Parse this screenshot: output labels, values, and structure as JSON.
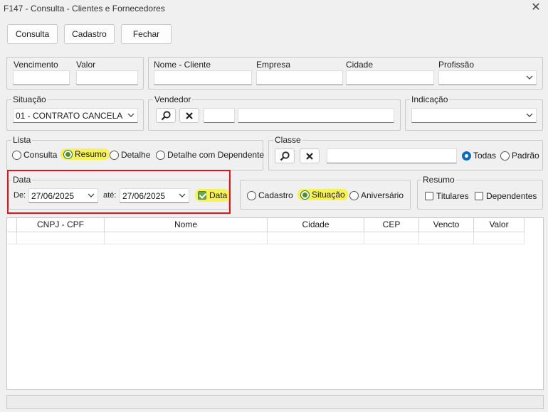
{
  "window": {
    "title": "F147 - Consulta - Clientes e Fornecedores",
    "close": "✕"
  },
  "toolbar": {
    "consulta": "Consulta",
    "cadastro": "Cadastro",
    "fechar": "Fechar"
  },
  "filters": {
    "vencimento": {
      "label": "Vencimento",
      "value": ""
    },
    "valor": {
      "label": "Valor",
      "value": ""
    },
    "nome_cliente": {
      "label": "Nome - Cliente",
      "value": ""
    },
    "empresa": {
      "label": "Empresa",
      "value": ""
    },
    "cidade": {
      "label": "Cidade",
      "value": ""
    },
    "profissao": {
      "label": "Profissão",
      "value": ""
    },
    "situacao": {
      "label": "Situação",
      "value": "01 - CONTRATO CANCELA"
    },
    "vendedor": {
      "label": "Vendedor",
      "code": "",
      "name": ""
    },
    "indicacao": {
      "label": "Indicação",
      "value": ""
    },
    "lista": {
      "label": "Lista",
      "options": [
        "Consulta",
        "Resumo",
        "Detalhe",
        "Detalhe com Dependente"
      ],
      "selected": "Resumo"
    },
    "classe": {
      "label": "Classe",
      "value": "",
      "options": [
        "Todas",
        "Padrão"
      ],
      "selected": "Todas"
    },
    "data": {
      "label": "Data",
      "de_label": "De:",
      "ate_label": "até:",
      "de_value": "27/06/2025",
      "ate_value": "27/06/2025",
      "checkbox_label": "Data",
      "checked": true
    },
    "tipo_data": {
      "options": [
        "Cadastro",
        "Situação",
        "Aniversário"
      ],
      "selected": "Situação"
    },
    "resumo": {
      "label": "Resumo",
      "titulares": {
        "label": "Titulares",
        "checked": false
      },
      "dependentes": {
        "label": "Dependentes",
        "checked": false
      }
    }
  },
  "table": {
    "columns": [
      "CNPJ - CPF",
      "Nome",
      "Cidade",
      "CEP",
      "Vencto",
      "Valor"
    ],
    "rows": []
  },
  "colors": {
    "highlight": "#f6f35a",
    "red_box": "#e3131b",
    "radio_selected": "#0a6ebd"
  }
}
